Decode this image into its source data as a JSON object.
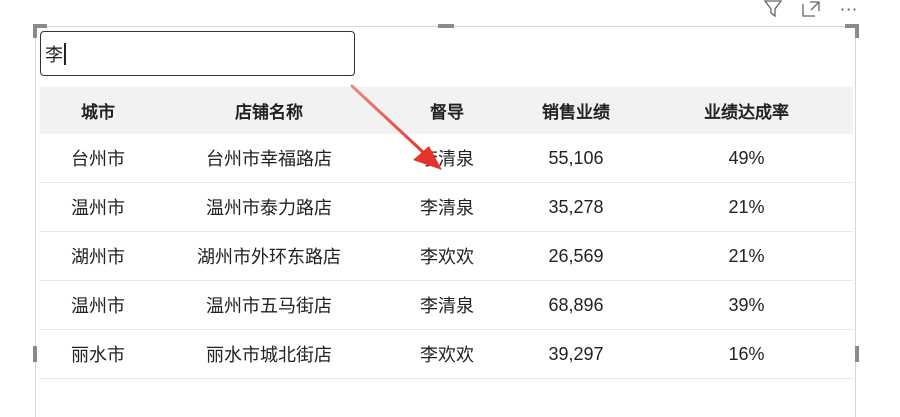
{
  "toolbar": {
    "icons": [
      "filter-icon",
      "focus-mode-icon",
      "more-options-icon"
    ],
    "more_label": "···"
  },
  "search": {
    "value": "李"
  },
  "table": {
    "headers": [
      "城市",
      "店铺名称",
      "督导",
      "销售业绩",
      "业绩达成率"
    ],
    "rows": [
      [
        "台州市",
        "台州市幸福路店",
        "李清泉",
        "55,106",
        "49%"
      ],
      [
        "温州市",
        "温州市泰力路店",
        "李清泉",
        "35,278",
        "21%"
      ],
      [
        "湖州市",
        "湖州市外环东路店",
        "李欢欢",
        "26,569",
        "21%"
      ],
      [
        "温州市",
        "温州市五马街店",
        "李清泉",
        "68,896",
        "39%"
      ],
      [
        "丽水市",
        "丽水市城北街店",
        "李欢欢",
        "39,297",
        "16%"
      ]
    ]
  },
  "annotation": {
    "arrow_color": "#e8322b"
  }
}
